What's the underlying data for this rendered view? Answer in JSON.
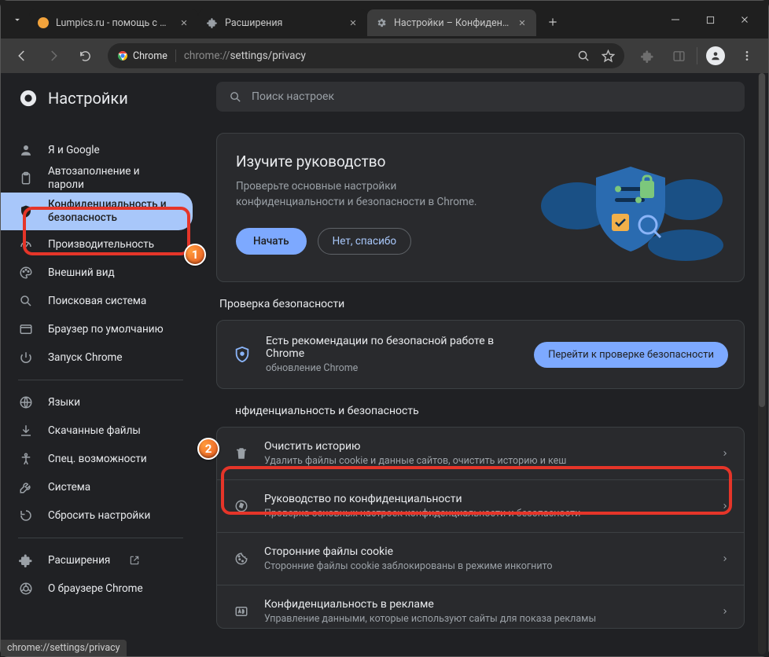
{
  "tabs": [
    {
      "title": "Lumpics.ru - помощь с комп",
      "active": false,
      "favicon": "orange-circle"
    },
    {
      "title": "Расширения",
      "active": false,
      "favicon": "puzzle"
    },
    {
      "title": "Настройки – Конфиденциа",
      "active": true,
      "favicon": "gear"
    }
  ],
  "url": {
    "chip": "Chrome",
    "scheme": "chrome://",
    "path": "settings/privacy"
  },
  "app_title": "Настройки",
  "search_placeholder": "Поиск настроек",
  "sidebar": {
    "items": [
      {
        "icon": "person",
        "label": "Я и Google"
      },
      {
        "icon": "clipboard",
        "label": "Автозаполнение и пароли"
      },
      {
        "icon": "shield",
        "label": "Конфиденциальность и безопасность",
        "active": true
      },
      {
        "icon": "gauge",
        "label": "Производительность"
      },
      {
        "icon": "palette",
        "label": "Внешний вид"
      },
      {
        "icon": "search",
        "label": "Поисковая система"
      },
      {
        "icon": "browser",
        "label": "Браузер по умолчанию"
      },
      {
        "icon": "power",
        "label": "Запуск Chrome"
      }
    ],
    "items2": [
      {
        "icon": "globe",
        "label": "Языки"
      },
      {
        "icon": "download",
        "label": "Скачанные файлы"
      },
      {
        "icon": "accessibility",
        "label": "Спец. возможности"
      },
      {
        "icon": "wrench",
        "label": "Система"
      },
      {
        "icon": "reset",
        "label": "Сбросить настройки"
      }
    ],
    "items3": [
      {
        "icon": "puzzle",
        "label": "Расширения",
        "external": true
      },
      {
        "icon": "chrome",
        "label": "О браузере Chrome"
      }
    ]
  },
  "guide": {
    "title": "Изучите руководство",
    "subtitle": "Проверьте основные настройки конфиденциальности и безопасности в Chrome.",
    "start": "Начать",
    "dismiss": "Нет, спасибо"
  },
  "safety_header": "Проверка безопасности",
  "safety": {
    "title": "Есть рекомендации по безопасной работе в Chrome",
    "subtitle": "обновление Chrome",
    "button": "Перейти к проверке безопасности"
  },
  "privacy_header": "нфиденциальность и безопасность",
  "rows": [
    {
      "icon": "trash",
      "title": "Очистить историю",
      "subtitle": "Удалить файлы cookie и данные сайтов, очистить историю и кеш"
    },
    {
      "icon": "compass",
      "title": "Руководство по конфиденциальности",
      "subtitle": "Проверка основных настроек конфиденциальности и безопасности"
    },
    {
      "icon": "cookie",
      "title": "Сторонние файлы cookie",
      "subtitle": "Сторонние файлы cookie заблокированы в режиме инкогнито"
    },
    {
      "icon": "ad",
      "title": "Конфиденциальность в рекламе",
      "subtitle": "Управление данными, которые используют сайты для показа рекламы"
    }
  ],
  "annotations": {
    "badge1": "1",
    "badge2": "2"
  },
  "status_url": "chrome://settings/privacy"
}
